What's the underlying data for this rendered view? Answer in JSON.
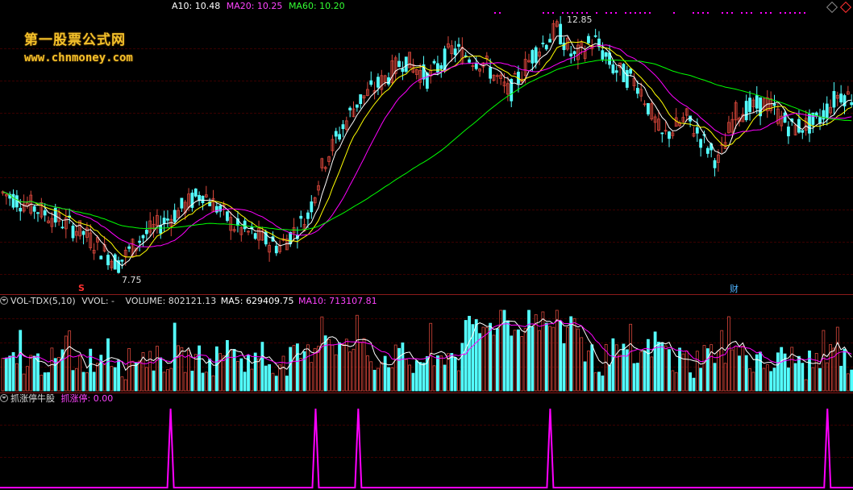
{
  "price_header": {
    "ma10": "A10: 10.48",
    "ma20": "MA20: 10.25",
    "ma60": "MA60: 10.20"
  },
  "watermark": {
    "line1": "第一股票公式网",
    "line2": "www.chnmoney.com"
  },
  "price_annotations": {
    "high": "12.85",
    "low": "7.75",
    "marker_s": "S",
    "marker_cai": "财"
  },
  "volume_header": {
    "indicator": "VOL-TDX(5,10)",
    "vvol": "VVOL: -",
    "volume": "VOLUME: 802121.13",
    "ma5": "MA5: 629409.75",
    "ma10": "MA10: 713107.81"
  },
  "indicator_header": {
    "name": "抓涨停牛股",
    "value": "抓涨停: 0.00"
  },
  "colors": {
    "up": "#d9473b",
    "down": "#54ffff",
    "ma5": "#ffffff",
    "ma10": "#ffff00",
    "ma20": "#ff00ff",
    "ma60": "#00ff00",
    "signal": "#ff00ff",
    "watermark": "#f3c12b"
  },
  "icons": [
    "collapse-circle-icon",
    "diamond-icon"
  ],
  "chart_data": [
    {
      "type": "candlestick",
      "title": "",
      "series": [
        {
          "name": "MA10",
          "values": [
            10.48
          ]
        },
        {
          "name": "MA20",
          "values": [
            10.25
          ]
        },
        {
          "name": "MA60",
          "values": [
            10.2
          ]
        }
      ],
      "annotations": [
        {
          "label": "12.85",
          "kind": "high"
        },
        {
          "label": "7.75",
          "kind": "low"
        }
      ],
      "ylim": [
        7.5,
        13.0
      ]
    },
    {
      "type": "bar",
      "title": "VOL-TDX(5,10)",
      "series": [
        {
          "name": "VOLUME",
          "values": [
            802121.13
          ]
        },
        {
          "name": "MA5",
          "values": [
            629409.75
          ]
        },
        {
          "name": "MA10",
          "values": [
            713107.81
          ]
        }
      ]
    },
    {
      "type": "line",
      "title": "抓涨停牛股",
      "series": [
        {
          "name": "抓涨停",
          "values": [
            0.0
          ]
        }
      ],
      "spike_positions_pct": [
        20,
        37,
        42,
        64.5,
        97
      ]
    }
  ]
}
